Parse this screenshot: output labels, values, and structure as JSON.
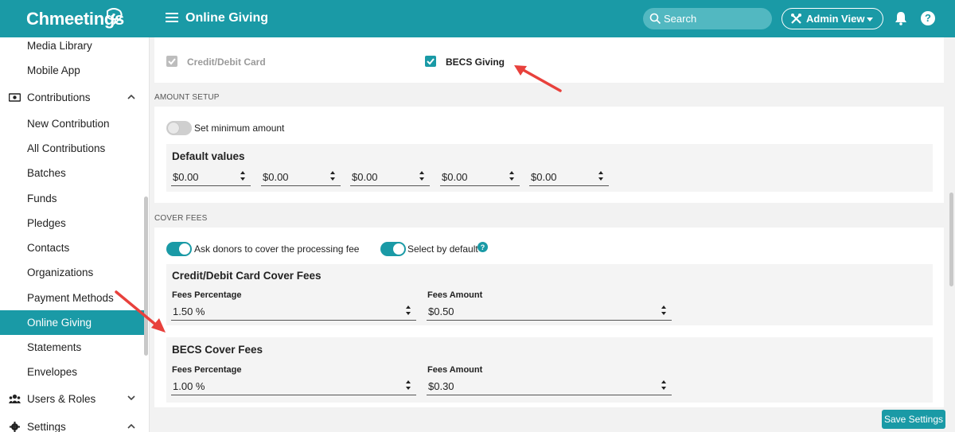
{
  "app": {
    "brand": "Chmeetings",
    "page_title": "Online Giving"
  },
  "header": {
    "search_placeholder": "Search",
    "admin_view_label": "Admin View",
    "help_label": "?"
  },
  "colors": {
    "accent": "#1a9aa6",
    "annotation_arrow": "#e8413c"
  },
  "sidebar": {
    "items": [
      {
        "label": "Media Library",
        "kind": "sub"
      },
      {
        "label": "Mobile App",
        "kind": "sub"
      },
      {
        "label": "Contributions",
        "kind": "group",
        "icon": "money-icon",
        "expanded": true
      },
      {
        "label": "New Contribution",
        "kind": "sub"
      },
      {
        "label": "All Contributions",
        "kind": "sub"
      },
      {
        "label": "Batches",
        "kind": "sub"
      },
      {
        "label": "Funds",
        "kind": "sub"
      },
      {
        "label": "Pledges",
        "kind": "sub"
      },
      {
        "label": "Contacts",
        "kind": "sub"
      },
      {
        "label": "Organizations",
        "kind": "sub"
      },
      {
        "label": "Payment Methods",
        "kind": "sub"
      },
      {
        "label": "Online Giving",
        "kind": "sub",
        "active": true
      },
      {
        "label": "Statements",
        "kind": "sub"
      },
      {
        "label": "Envelopes",
        "kind": "sub"
      },
      {
        "label": "Users & Roles",
        "kind": "group",
        "icon": "users-icon",
        "expanded": false
      },
      {
        "label": "Settings",
        "kind": "group",
        "icon": "gear-icon",
        "expanded": true
      }
    ]
  },
  "payment_methods": {
    "credit_card": {
      "label": "Credit/Debit Card",
      "checked": true,
      "disabled": true
    },
    "becs": {
      "label": "BECS Giving",
      "checked": true
    }
  },
  "amount_setup": {
    "section_label": "AMOUNT SETUP",
    "min_amount_label": "Set minimum amount",
    "min_amount_enabled": false,
    "default_values_title": "Default values",
    "default_values": [
      "$0.00",
      "$0.00",
      "$0.00",
      "$0.00",
      "$0.00"
    ]
  },
  "cover_fees": {
    "section_label": "COVER FEES",
    "ask_donors_label": "Ask donors to cover the processing fee",
    "ask_donors_enabled": true,
    "select_default_label": "Select by default",
    "select_default_enabled": true,
    "card": {
      "title": "Credit/Debit Card Cover Fees",
      "percentage_label": "Fees Percentage",
      "percentage_value": "1.50 %",
      "amount_label": "Fees Amount",
      "amount_value": "$0.50"
    },
    "becs": {
      "title": "BECS Cover Fees",
      "percentage_label": "Fees Percentage",
      "percentage_value": "1.00 %",
      "amount_label": "Fees Amount",
      "amount_value": "$0.30"
    }
  },
  "footer": {
    "save_label": "Save Settings"
  }
}
